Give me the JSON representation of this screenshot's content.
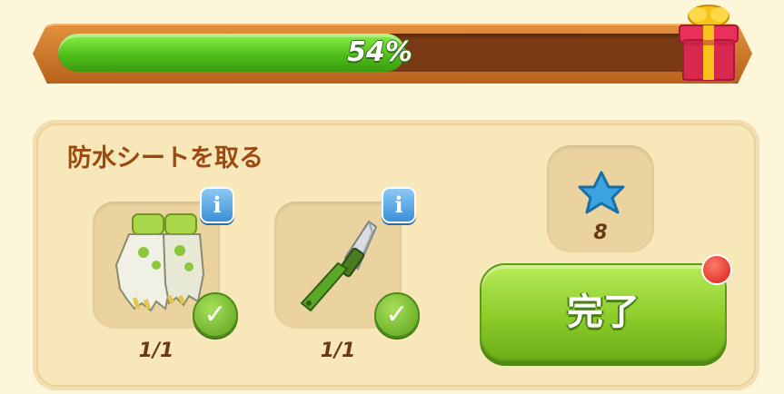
{
  "progress": {
    "percent": 54,
    "label": "54%"
  },
  "task": {
    "title": "防水シートを取る",
    "items": [
      {
        "icon": "gloves-icon",
        "count": "1/1",
        "completed": true,
        "info": "i"
      },
      {
        "icon": "knife-icon",
        "count": "1/1",
        "completed": true,
        "info": "i"
      }
    ]
  },
  "reward": {
    "icon": "blue-star-icon",
    "count": "8"
  },
  "complete_button": {
    "label": "完了",
    "notification": true
  },
  "colors": {
    "accent_green": "#8ccd2a",
    "progress_green": "#4cbb17",
    "title_brown": "#9c4a12",
    "info_blue": "#3a8fd8"
  }
}
